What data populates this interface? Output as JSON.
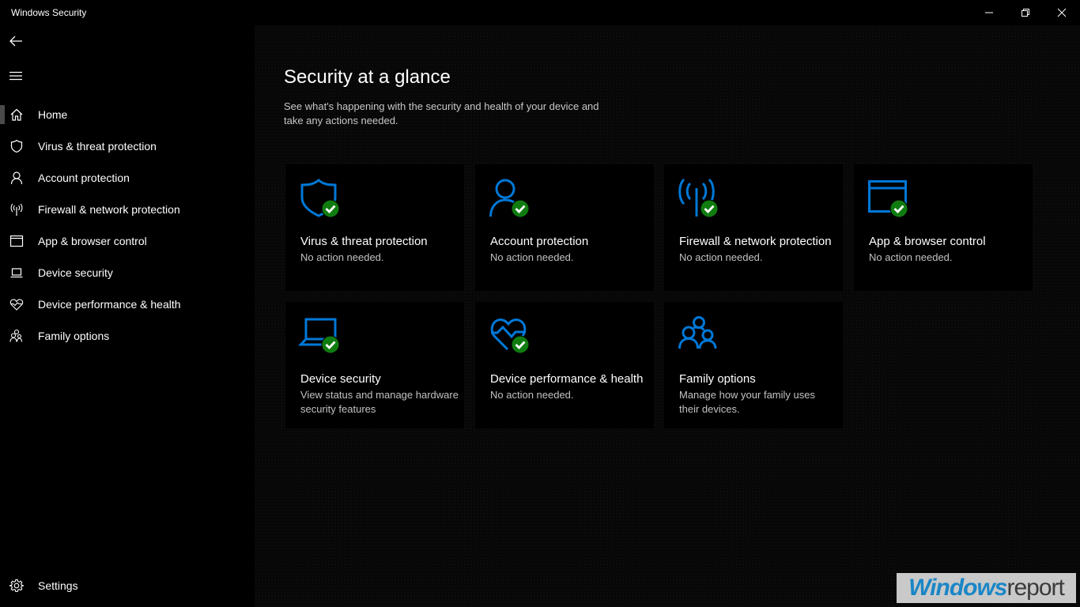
{
  "window": {
    "title": "Windows Security",
    "controls": {
      "minimize": "minimize",
      "restore": "restore",
      "close": "close"
    }
  },
  "sidebar": {
    "back_icon": "back-arrow-icon",
    "menu_icon": "hamburger-icon",
    "items": [
      {
        "label": "Home",
        "icon": "home-icon",
        "selected": true
      },
      {
        "label": "Virus & threat protection",
        "icon": "shield-icon"
      },
      {
        "label": "Account protection",
        "icon": "person-icon"
      },
      {
        "label": "Firewall & network protection",
        "icon": "antenna-icon"
      },
      {
        "label": "App & browser control",
        "icon": "browser-window-icon"
      },
      {
        "label": "Device security",
        "icon": "laptop-icon"
      },
      {
        "label": "Device performance & health",
        "icon": "heart-pulse-icon"
      },
      {
        "label": "Family options",
        "icon": "family-icon"
      }
    ],
    "settings": {
      "label": "Settings",
      "icon": "gear-icon"
    }
  },
  "main": {
    "title": "Security at a glance",
    "description": "See what's happening with the security and health of your device and take any actions needed.",
    "cards": [
      {
        "title": "Virus & threat protection",
        "subtitle": "No action needed.",
        "icon": "shield-icon",
        "status": "ok"
      },
      {
        "title": "Account protection",
        "subtitle": "No action needed.",
        "icon": "person-icon",
        "status": "ok"
      },
      {
        "title": "Firewall & network protection",
        "subtitle": "No action needed.",
        "icon": "antenna-icon",
        "status": "ok"
      },
      {
        "title": "App & browser control",
        "subtitle": "No action needed.",
        "icon": "browser-window-icon",
        "status": "ok"
      },
      {
        "title": "Device security",
        "subtitle": "View status and manage hardware security features",
        "icon": "laptop-icon",
        "status": "ok"
      },
      {
        "title": "Device performance & health",
        "subtitle": "No action needed.",
        "icon": "heart-pulse-icon",
        "status": "ok"
      },
      {
        "title": "Family options",
        "subtitle": "Manage how your family uses their devices.",
        "icon": "family-icon",
        "status": "none"
      }
    ]
  },
  "colors": {
    "accent": "#0078d7",
    "ok_badge": "#107c10",
    "background": "#000000",
    "text_secondary": "#c2c2c2"
  },
  "watermark": {
    "part1": "Windows",
    "part2": "report"
  }
}
